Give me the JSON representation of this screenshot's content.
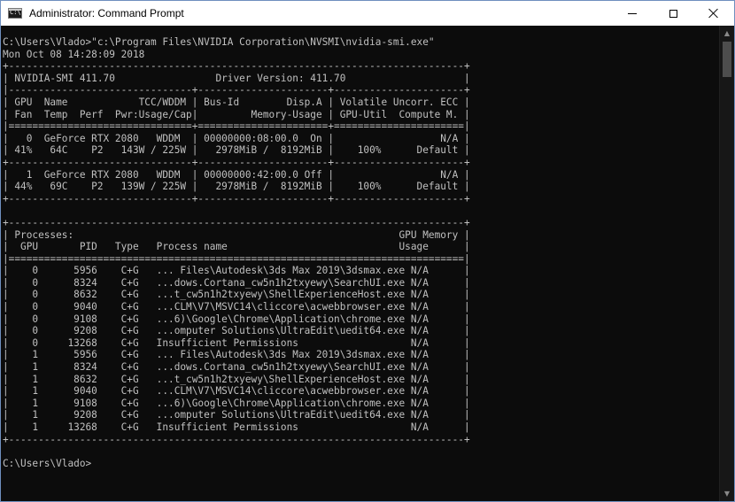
{
  "window": {
    "title": "Administrator: Command Prompt",
    "icon_text": "C:\\"
  },
  "icons": {
    "app": "command-prompt-icon",
    "minimize": "minimize-icon",
    "maximize": "maximize-icon",
    "close": "close-icon"
  },
  "colors": {
    "console_background": "#0c0c0c",
    "console_text": "#c0c0c0",
    "titlebar_background": "#ffffff",
    "window_border": "#6f8fbf"
  },
  "console": {
    "lines": [
      "C:\\Users\\Vlado>\"c:\\Program Files\\NVIDIA Corporation\\NVSMI\\nvidia-smi.exe\"",
      "Mon Oct 08 14:28:09 2018",
      "+-----------------------------------------------------------------------------+",
      "| NVIDIA-SMI 411.70                 Driver Version: 411.70                    |",
      "|-------------------------------+----------------------+----------------------+",
      "| GPU  Name            TCC/WDDM | Bus-Id        Disp.A | Volatile Uncorr. ECC |",
      "| Fan  Temp  Perf  Pwr:Usage/Cap|         Memory-Usage | GPU-Util  Compute M. |",
      "|===============================+======================+======================|",
      "|   0  GeForce RTX 2080   WDDM  | 00000000:08:00.0  On |                  N/A |",
      "| 41%   64C    P2   143W / 225W |   2978MiB /  8192MiB |    100%      Default |",
      "+-------------------------------+----------------------+----------------------+",
      "|   1  GeForce RTX 2080   WDDM  | 00000000:42:00.0 Off |                  N/A |",
      "| 44%   69C    P2   139W / 225W |   2978MiB /  8192MiB |    100%      Default |",
      "+-------------------------------+----------------------+----------------------+",
      "",
      "+-----------------------------------------------------------------------------+",
      "| Processes:                                                       GPU Memory |",
      "|  GPU       PID   Type   Process name                             Usage      |",
      "|=============================================================================|",
      "|    0      5956    C+G   ... Files\\Autodesk\\3ds Max 2019\\3dsmax.exe N/A      |",
      "|    0      8324    C+G   ...dows.Cortana_cw5n1h2txyewy\\SearchUI.exe N/A      |",
      "|    0      8632    C+G   ...t_cw5n1h2txyewy\\ShellExperienceHost.exe N/A      |",
      "|    0      9040    C+G   ...CLM\\V7\\MSVC14\\cliccore\\acwebbrowser.exe N/A      |",
      "|    0      9108    C+G   ...6)\\Google\\Chrome\\Application\\chrome.exe N/A      |",
      "|    0      9208    C+G   ...omputer Solutions\\UltraEdit\\uedit64.exe N/A      |",
      "|    0     13268    C+G   Insufficient Permissions                   N/A      |",
      "|    1      5956    C+G   ... Files\\Autodesk\\3ds Max 2019\\3dsmax.exe N/A      |",
      "|    1      8324    C+G   ...dows.Cortana_cw5n1h2txyewy\\SearchUI.exe N/A      |",
      "|    1      8632    C+G   ...t_cw5n1h2txyewy\\ShellExperienceHost.exe N/A      |",
      "|    1      9040    C+G   ...CLM\\V7\\MSVC14\\cliccore\\acwebbrowser.exe N/A      |",
      "|    1      9108    C+G   ...6)\\Google\\Chrome\\Application\\chrome.exe N/A      |",
      "|    1      9208    C+G   ...omputer Solutions\\UltraEdit\\uedit64.exe N/A      |",
      "|    1     13268    C+G   Insufficient Permissions                   N/A      |",
      "+-----------------------------------------------------------------------------+",
      "",
      "C:\\Users\\Vlado>"
    ]
  }
}
